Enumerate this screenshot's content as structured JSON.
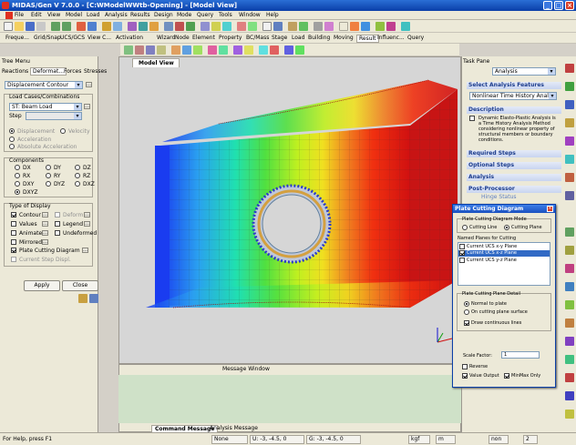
{
  "titlebar": {
    "title": "MIDAS/Gen V 7.0.0 - [C:WModelWWtb-Opening] - [Model View]"
  },
  "menu": [
    "File",
    "Edit",
    "View",
    "Model",
    "Load",
    "Analysis",
    "Results",
    "Design",
    "Mode",
    "Query",
    "Tools",
    "Window",
    "Help"
  ],
  "toolbar_tabs": [
    "Freque...",
    "Grid/Snap",
    "UCS/GCS",
    "View C...",
    "Activation"
  ],
  "toolbar_tabs2": [
    "Wizard",
    "Node",
    "Element",
    "Property",
    "BC/Mass",
    "Stage",
    "Load",
    "Building",
    "Moving",
    "Result",
    "Influenc...",
    "Query"
  ],
  "tree": {
    "title": "Tree Menu",
    "tabs": [
      "Reactions",
      "Deformat...",
      "Forces",
      "Stresses"
    ],
    "contour_select": "Displacement Contour",
    "load_cases_label": "Load Cases/Combinations",
    "load_case": "ST: Beam Load",
    "step_label": "Step",
    "options": [
      "Displacement",
      "Velocity",
      "Acceleration",
      "Absolute Acceleration"
    ],
    "components_label": "Components",
    "components": [
      "DX",
      "DY",
      "DZ",
      "RX",
      "RY",
      "RZ",
      "DXY",
      "DYZ",
      "DXZ",
      "DXYZ"
    ],
    "display_label": "Type of Display",
    "display": {
      "contour": "Contour",
      "deform": "Deform",
      "values": "Values",
      "legend": "Legend",
      "animate": "Animate",
      "undeformed": "Undeformed",
      "mirrored": "Mirrored",
      "plate_cutting": "Plate Cutting Diagram",
      "current_step": "Current Step Displ."
    },
    "apply": "Apply",
    "close": "Close"
  },
  "view_tab": "Model View",
  "message_window": {
    "title": "Message Window",
    "tabs": [
      "Command Message",
      "Analysis Message"
    ]
  },
  "task": {
    "title": "Task Pane",
    "dropdown": "Analysis",
    "select_label": "Select Analysis Features",
    "select_value": "Nonlinear Time History Analysis",
    "description": "Description",
    "desc_text": "Dynamic Elasto-Plastic Analysis is a Time History Analysis Method considering nonlinear property of structural members or boundary conditions.",
    "sections": [
      "Required Steps",
      "Optional Steps",
      "Analysis",
      "Post-Processor"
    ],
    "post_link": "Hinge Status"
  },
  "dialog": {
    "title": "Plate Cutting Diagram",
    "mode_label": "Plate Cutting Diagram Mode",
    "mode_line": "Cutting Line",
    "mode_plane": "Cutting Plane",
    "named_label": "Named Planes for Cutting",
    "planes": [
      "Current UCS x-y Plane",
      "Current UCS x-z Plane",
      "Current UCS y-z Plane"
    ],
    "detail_label": "Plate Cutting Plane Detail",
    "normal": "Normal to plate",
    "on_surface": "On cutting plane surface",
    "draw_cont": "Draw continuous lines",
    "scale_label": "Scale Factor:",
    "scale_value": "1",
    "reverse": "Reverse",
    "value_output": "Value Output",
    "minmax": "MinMax Only"
  },
  "status": {
    "help": "For Help, press F1",
    "none": "None",
    "coord1": "U: -3, -4.5, 0",
    "coord2": "G: -3, -4.5, 0",
    "unit1": "kgf",
    "unit2": "m",
    "none2": "non",
    "num": "2"
  },
  "colors": {
    "accent": "#0a3fa8",
    "panel": "#ece9d8"
  }
}
